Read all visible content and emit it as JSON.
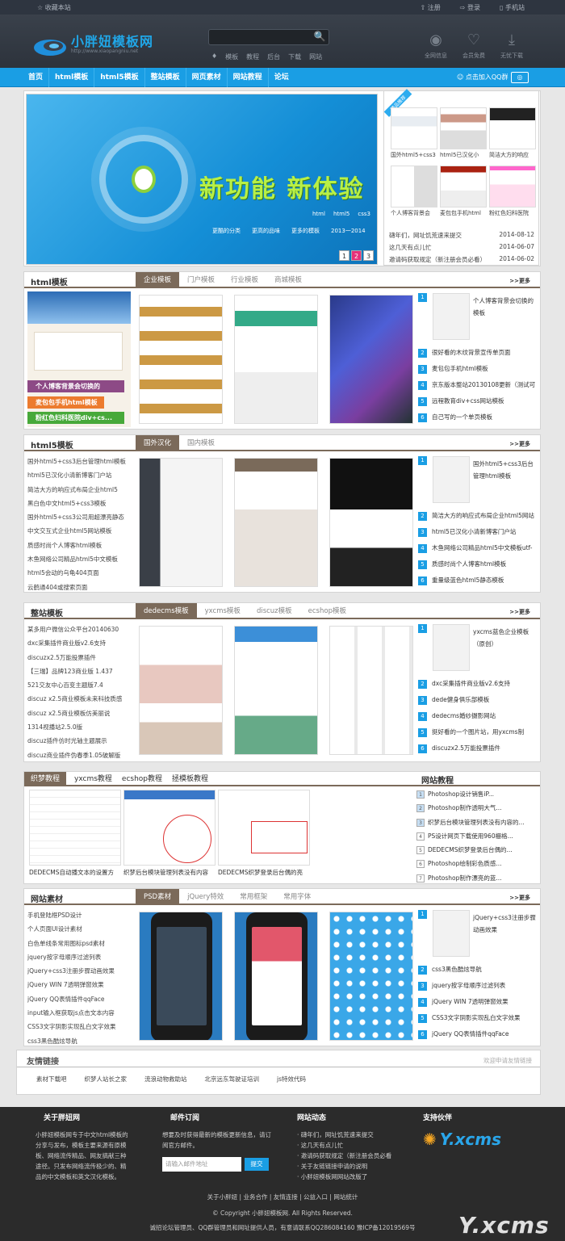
{
  "topbar": {
    "favorite": "收藏本站",
    "register": "注册",
    "login": "登录",
    "mobile": "手机站"
  },
  "header": {
    "logo_title": "小胖妞模板网",
    "logo_url": "http://www.xiaopangniu.net",
    "search_button": "🔍",
    "hotwords": [
      "模板",
      "教程",
      "后台",
      "下载",
      "网站"
    ],
    "icons": [
      {
        "label": "全网信息",
        "icon": "signal-icon"
      },
      {
        "label": "会员免费",
        "icon": "heart-icon"
      },
      {
        "label": "无忧下载",
        "icon": "download-icon"
      }
    ]
  },
  "nav": {
    "items": [
      "首页",
      "html模板",
      "html5模板",
      "整站模板",
      "网页素材",
      "网站教程",
      "论坛"
    ],
    "qq": "点击加入QQ群",
    "weibo": "微博"
  },
  "banner": {
    "slogan": "新功能 新体验",
    "sub": [
      "html",
      "html5",
      "css3"
    ],
    "bottom": [
      "更酷的分类",
      "更高的品味",
      "更多的模板",
      "2013一2014"
    ],
    "pager": [
      "1",
      "2",
      "3"
    ]
  },
  "hot": {
    "flag": "精品推荐",
    "thumbs": [
      "国外html5+css3",
      "html5已汉化小",
      "简洁大方的响应",
      "个人博客背景会",
      "麦包包手机html",
      "粉红色妇科医院"
    ],
    "news": [
      {
        "title": "礴年们，网址饥荒速来提交",
        "date": "2014-08-12"
      },
      {
        "title": "这几天有点儿忙",
        "date": "2014-06-07"
      },
      {
        "title": "邀请码获取规定（新注册会员必看）",
        "date": "2014-06-02"
      }
    ]
  },
  "sec1": {
    "title": "html模板",
    "tabs": [
      "企业模板",
      "门户模板",
      "行业模板",
      "商城模板"
    ],
    "more": ">>更多",
    "hero_bars": [
      "个人博客背景会切换的",
      "麦包包手机html模板",
      "粉红色妇科医院div+cs..."
    ],
    "rank_first": "个人博客背景会切换的模板",
    "rank": [
      "很好看的木纹背景宣传单页面",
      "麦包包手机html模板",
      "京东版本整站20130108更新（测试可",
      "远程教育div+css网站模板",
      "自己写的一个单页模板"
    ]
  },
  "sec2": {
    "title": "html5模板",
    "tabs": [
      "国外汉化",
      "国内模板"
    ],
    "more": ">>更多",
    "list": [
      "国外html5+css3后台管理html模板",
      "html5已汉化小清新博客门户站",
      "简洁大方的响应式布局企业html5",
      "黑白色中文html5+css3模板",
      "国外html5+css3公司用超漂亮静态",
      "中文交互式企业html5网站模板",
      "质感时尚个人博客html模板",
      "木鱼网络公司精品html5中文模板",
      "html5会动的乌龟404页面",
      "云鹤通404或搜索页面"
    ],
    "rank_first": "国外html5+css3后台管理html模板",
    "rank": [
      "简洁大方的响应式布局企业html5网站",
      "html5已汉化小清新博客门户站",
      "木鱼网络公司精品html5中文模板utf-",
      "质感时尚个人博客html模板",
      "重量级蓝色html5静态模板"
    ]
  },
  "sec3": {
    "title": "整站模板",
    "tabs": [
      "dedecms模板",
      "yxcms模板",
      "discuz模板",
      "ecshop模板"
    ],
    "more": ">>更多",
    "list": [
      "某多用户微信公众平台20140630",
      "dxc采集插件商业版v2.6支持",
      "discuzx2.5万能投票插件",
      "【三瑞】品牌123商业版 1.437",
      "521交友中心百变主题版7.4",
      "discuz x2.5商业模板未来科技质感",
      "discuz x2.5商业模板仿美丽说",
      "1314视播站2.5.0版",
      "discuz插件仿时光轴主题展示",
      "discuz商业插件伪春季1.05破解版"
    ],
    "rank_first": "yxcms蓝色企业模板（原创）",
    "rank": [
      "dxc采集插件商业版v2.6支持",
      "dede健身俱乐部模板",
      "dedecms婚纱摄影网站",
      "挺好看的一个图片站，用yxcms制",
      "discuzx2.5万能投票插件"
    ]
  },
  "tut": {
    "tabs": [
      "织梦教程",
      "yxcms教程",
      "ecshop教程",
      "拯模板教程"
    ],
    "right_title": "网站教程",
    "caps": [
      "DEDECMS自动播文本的设置方",
      "织梦后台模块管理列表没有内容",
      "DEDECMS织梦登录后台偶的亮",
      "Photoshop设计销售i..."
    ],
    "list": [
      "Photoshop设计销售iP...",
      "Photoshop制作透明大气...",
      "织梦后台模块管理列表没有内容的...",
      "PS设计网页下载使用960栅格...",
      "DEDECMS织梦登录后台偶的...",
      "Photoshop绘制彩色质感...",
      "Photoshop制作漂亮的蓝..."
    ]
  },
  "sec4": {
    "title": "网站素材",
    "tabs": [
      "PSD素材",
      "jQuery特效",
      "常用框架",
      "常用字体"
    ],
    "more": ">>更多",
    "list": [
      "手机登陆框PSD设计",
      "个人页面UI设计素材",
      "白色单线条常用图标psd素材",
      "jquery按字母顺序过滤列表",
      "jQuery+css3注册步骤动画效果",
      "jQuery WIN 7透明弹窗效果",
      "jQuery QQ表情插件qqFace",
      "input输入框获取js点击文本内容",
      "CSS3文字阴影实现乱白文字效果",
      "css3黑色酷炫导航"
    ],
    "rank_first": "jQuery+css3注册步骤动画效果",
    "rank": [
      "css3黑色酷炫导航",
      "jquery按字母顺序过滤列表",
      "jQuery WIN 7透明弹窗效果",
      "CSS3文字阴影实现乱白文字效果",
      "jQuery QQ表情插件qqFace"
    ]
  },
  "friend": {
    "title": "友情链接",
    "apply": "欢迎申请友情链接",
    "links": [
      "素材下载吧",
      "织梦人站长之家",
      "流浪动物救助站",
      "北京远东驾驶证培训",
      "js特效代码"
    ]
  },
  "footer": {
    "about_title": "关于胖妞网",
    "about": "小胖妞模板网专于中文html模板的分享与发布，模板主要来源有原模板、网络流传精品、网友搞献三种途径。只发布网络流传极少的、精品的中文模板和英文汉化模板。",
    "mail_title": "邮件订阅",
    "mail_text": "想要及时获得最新的模板更新信息，请订阅官方邮件。",
    "mail_placeholder": "请输入邮件地址",
    "mail_btn": "提交",
    "news_title": "网站动态",
    "news": [
      "· 礴年们，网址饥荒速来提交",
      "· 这几天有点儿忙",
      "· 邀请码获取规定（新注册会员必看",
      "· 关于友链链接申请的说明",
      "· 小胖妞模板网网站改版了"
    ],
    "support_title": "支持伙伴",
    "support_logo": "Y.xcms",
    "links": "关于小胖妞 | 业务合作 | 友情连接 | 公益入口 | 网站统计",
    "copyright": "© Copyright 小胖妞模板网. All Rights Reserved.",
    "icp": "诚招论坛管理员、QQ群管理员和网址提供人员，有意请联系QQ286084160 豫ICP备12019569号",
    "watermark": "Y.xcms"
  }
}
